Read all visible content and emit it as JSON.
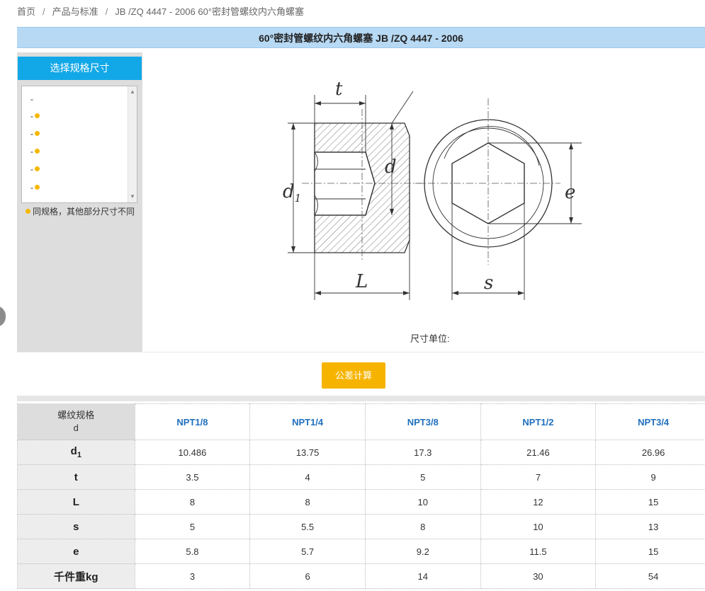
{
  "breadcrumb": {
    "home": "首页",
    "category": "产品与标准",
    "current": "JB /ZQ 4447 - 2006 60°密封管螺纹内六角螺塞",
    "separator": "/"
  },
  "title": "60°密封管螺纹内六角螺塞 JB /ZQ 4447 - 2006",
  "sidebar": {
    "header": "选择规格尺寸",
    "items": [
      "-",
      "-",
      "-",
      "-",
      "-",
      "-"
    ],
    "legend": "同规格，其他部分尺寸不同",
    "dot_color": "#f5b800"
  },
  "drawing": {
    "labels": {
      "t": "t",
      "d": "d",
      "d1": "d",
      "d1_sub": "1",
      "L": "L",
      "s": "s",
      "e": "e"
    },
    "unit_label": "尺寸单位:"
  },
  "calc_button": "公差计算",
  "table": {
    "corner_line1": "螺纹规格",
    "corner_line2": "d",
    "columns": [
      "NPT1/8",
      "NPT1/4",
      "NPT3/8",
      "NPT1/2",
      "NPT3/4"
    ],
    "rows": [
      {
        "label": "d",
        "sub": "1",
        "values": [
          "10.486",
          "13.75",
          "17.3",
          "21.46",
          "26.96"
        ]
      },
      {
        "label": "t",
        "sub": "",
        "values": [
          "3.5",
          "4",
          "5",
          "7",
          "9"
        ]
      },
      {
        "label": "L",
        "sub": "",
        "values": [
          "8",
          "8",
          "10",
          "12",
          "15"
        ]
      },
      {
        "label": "s",
        "sub": "",
        "values": [
          "5",
          "5.5",
          "8",
          "10",
          "13"
        ]
      },
      {
        "label": "e",
        "sub": "",
        "values": [
          "5.8",
          "5.7",
          "9.2",
          "11.5",
          "15"
        ]
      },
      {
        "label": "千件重kg",
        "sub": "",
        "values": [
          "3",
          "6",
          "14",
          "30",
          "54"
        ]
      }
    ]
  },
  "colors": {
    "title_bg": "#b7d9f4",
    "side_head": "#12a8e8",
    "button": "#f6b400",
    "link": "#1f6fbd"
  }
}
